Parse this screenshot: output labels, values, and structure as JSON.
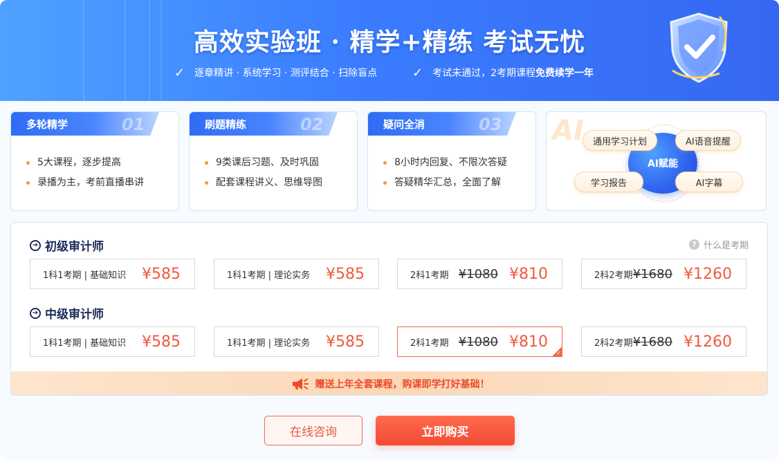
{
  "banner": {
    "title": "高效实验班 · 精学+精练 考试无忧",
    "sub1": "逐章精讲 · 系统学习 · 测评结合 · 扫除盲点",
    "sub2_prefix": "考试未通过，2考期课程",
    "sub2_bold": "免费续学一年"
  },
  "features": [
    {
      "title": "多轮精学",
      "num": "01",
      "points": [
        "5大课程，逐步提高",
        "录播为主，考前直播串讲"
      ]
    },
    {
      "title": "刷题精练",
      "num": "02",
      "points": [
        "9类课后习题、及时巩固",
        "配套课程讲义、思维导图"
      ]
    },
    {
      "title": "疑问全消",
      "num": "03",
      "points": [
        "8小时内回复、不限次答疑",
        "答疑精华汇总，全面了解"
      ]
    }
  ],
  "ai": {
    "watermark": "AI",
    "core": "AI赋能",
    "chips": [
      "通用学习计划",
      "AI语音提醒",
      "学习报告",
      "AI字幕"
    ]
  },
  "help_text": "什么是考期",
  "sections": [
    {
      "title": "初级审计师",
      "options": [
        {
          "label": "1科1考期 | 基础知识",
          "orig": "",
          "price": "¥585"
        },
        {
          "label": "1科1考期 | 理论实务",
          "orig": "",
          "price": "¥585"
        },
        {
          "label": "2科1考期",
          "orig": "¥1080",
          "price": "¥810"
        },
        {
          "label": "2科2考期",
          "orig": "¥1680",
          "price": "¥1260"
        }
      ]
    },
    {
      "title": "中级审计师",
      "options": [
        {
          "label": "1科1考期 | 基础知识",
          "orig": "",
          "price": "¥585"
        },
        {
          "label": "1科1考期 | 理论实务",
          "orig": "",
          "price": "¥585"
        },
        {
          "label": "2科1考期",
          "orig": "¥1080",
          "price": "¥810"
        },
        {
          "label": "2科2考期",
          "orig": "¥1680",
          "price": "¥1260"
        }
      ]
    }
  ],
  "promo": "赠送上年全套课程，购课即学打好基础！",
  "buttons": {
    "consult": "在线咨询",
    "buy": "立即购买"
  },
  "colors": {
    "accent_blue": "#3b7dff",
    "accent_red": "#f05a3c",
    "promo_bg": "#fcd7b8"
  }
}
